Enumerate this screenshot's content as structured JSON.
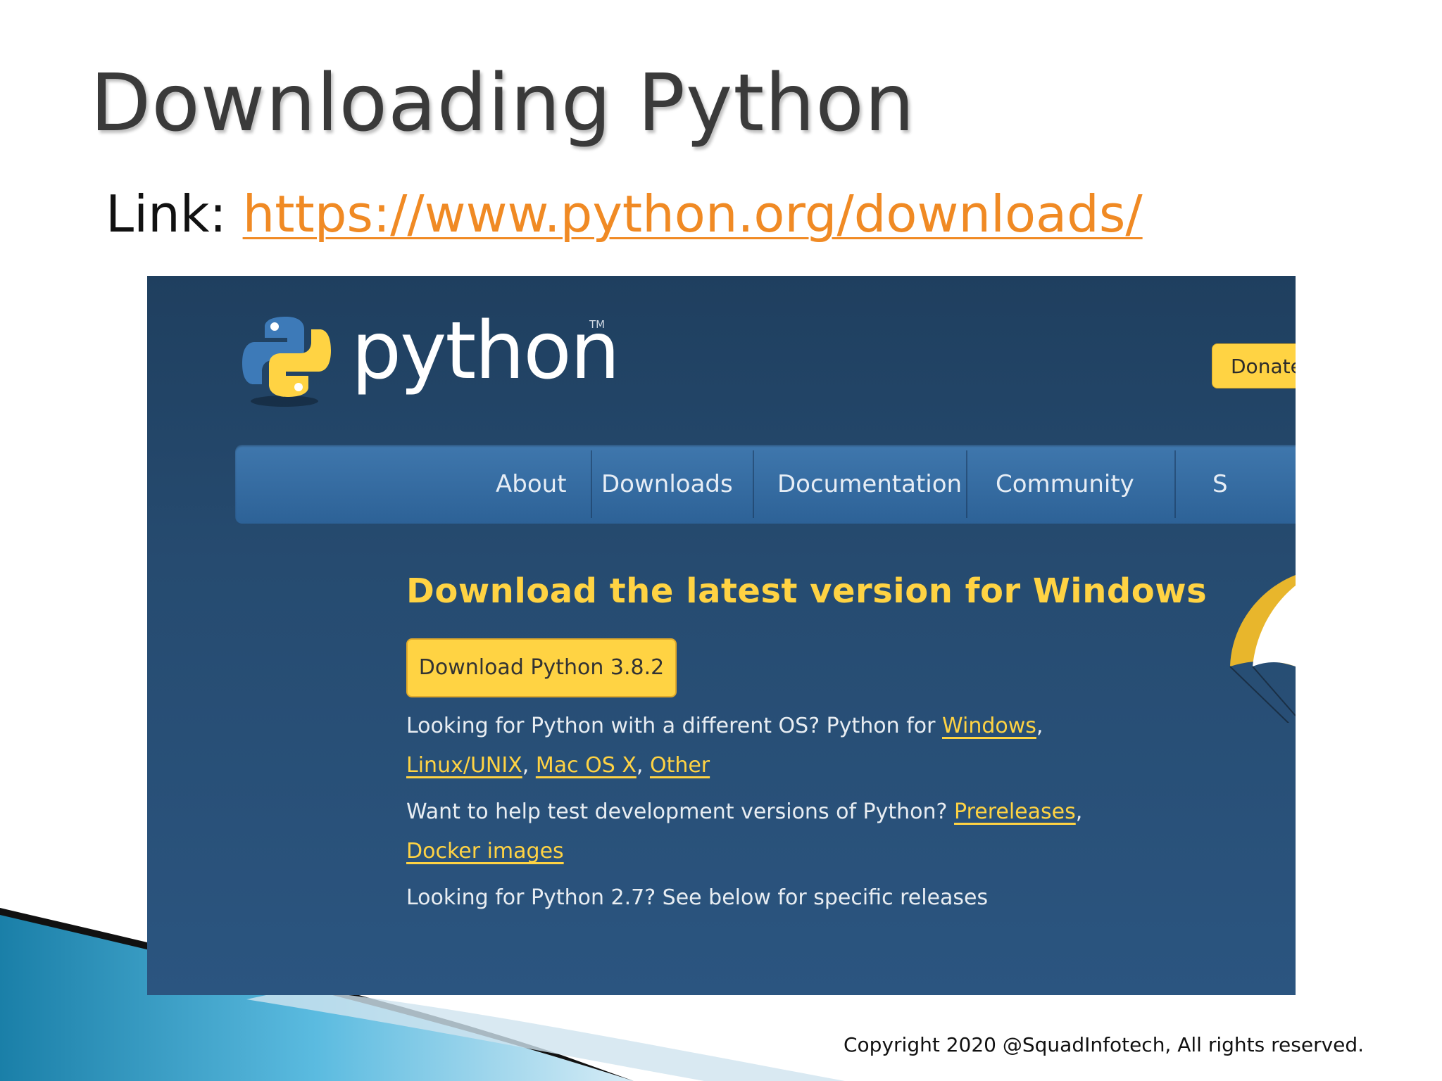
{
  "slide": {
    "title": "Downloading Python",
    "link_label": "Link: ",
    "link_url": "https://www.python.org/downloads/",
    "copyright": "Copyright 2020 @SquadInfotech, All rights reserved."
  },
  "site": {
    "logo_text": "python",
    "trademark": "TM",
    "donate_label": "Donate",
    "nav": [
      "About",
      "Downloads",
      "Documentation",
      "Community",
      "S"
    ],
    "headline": "Download the latest version for Windows",
    "download_button": "Download Python 3.8.2",
    "para1_text": "Looking for Python with a different OS? Python for ",
    "para1_links": [
      "Windows",
      "Linux/UNIX",
      "Mac OS X",
      "Other"
    ],
    "para2_text": "Want to help test development versions of Python? ",
    "para2_links": [
      "Prereleases",
      "Docker images"
    ],
    "para3_text": "Looking for Python 2.7? See below for specific releases"
  },
  "colors": {
    "accent_yellow": "#ffd343",
    "link_orange": "#f08a24",
    "site_background": "#264b70",
    "nav_blue": "#3f77ad"
  }
}
